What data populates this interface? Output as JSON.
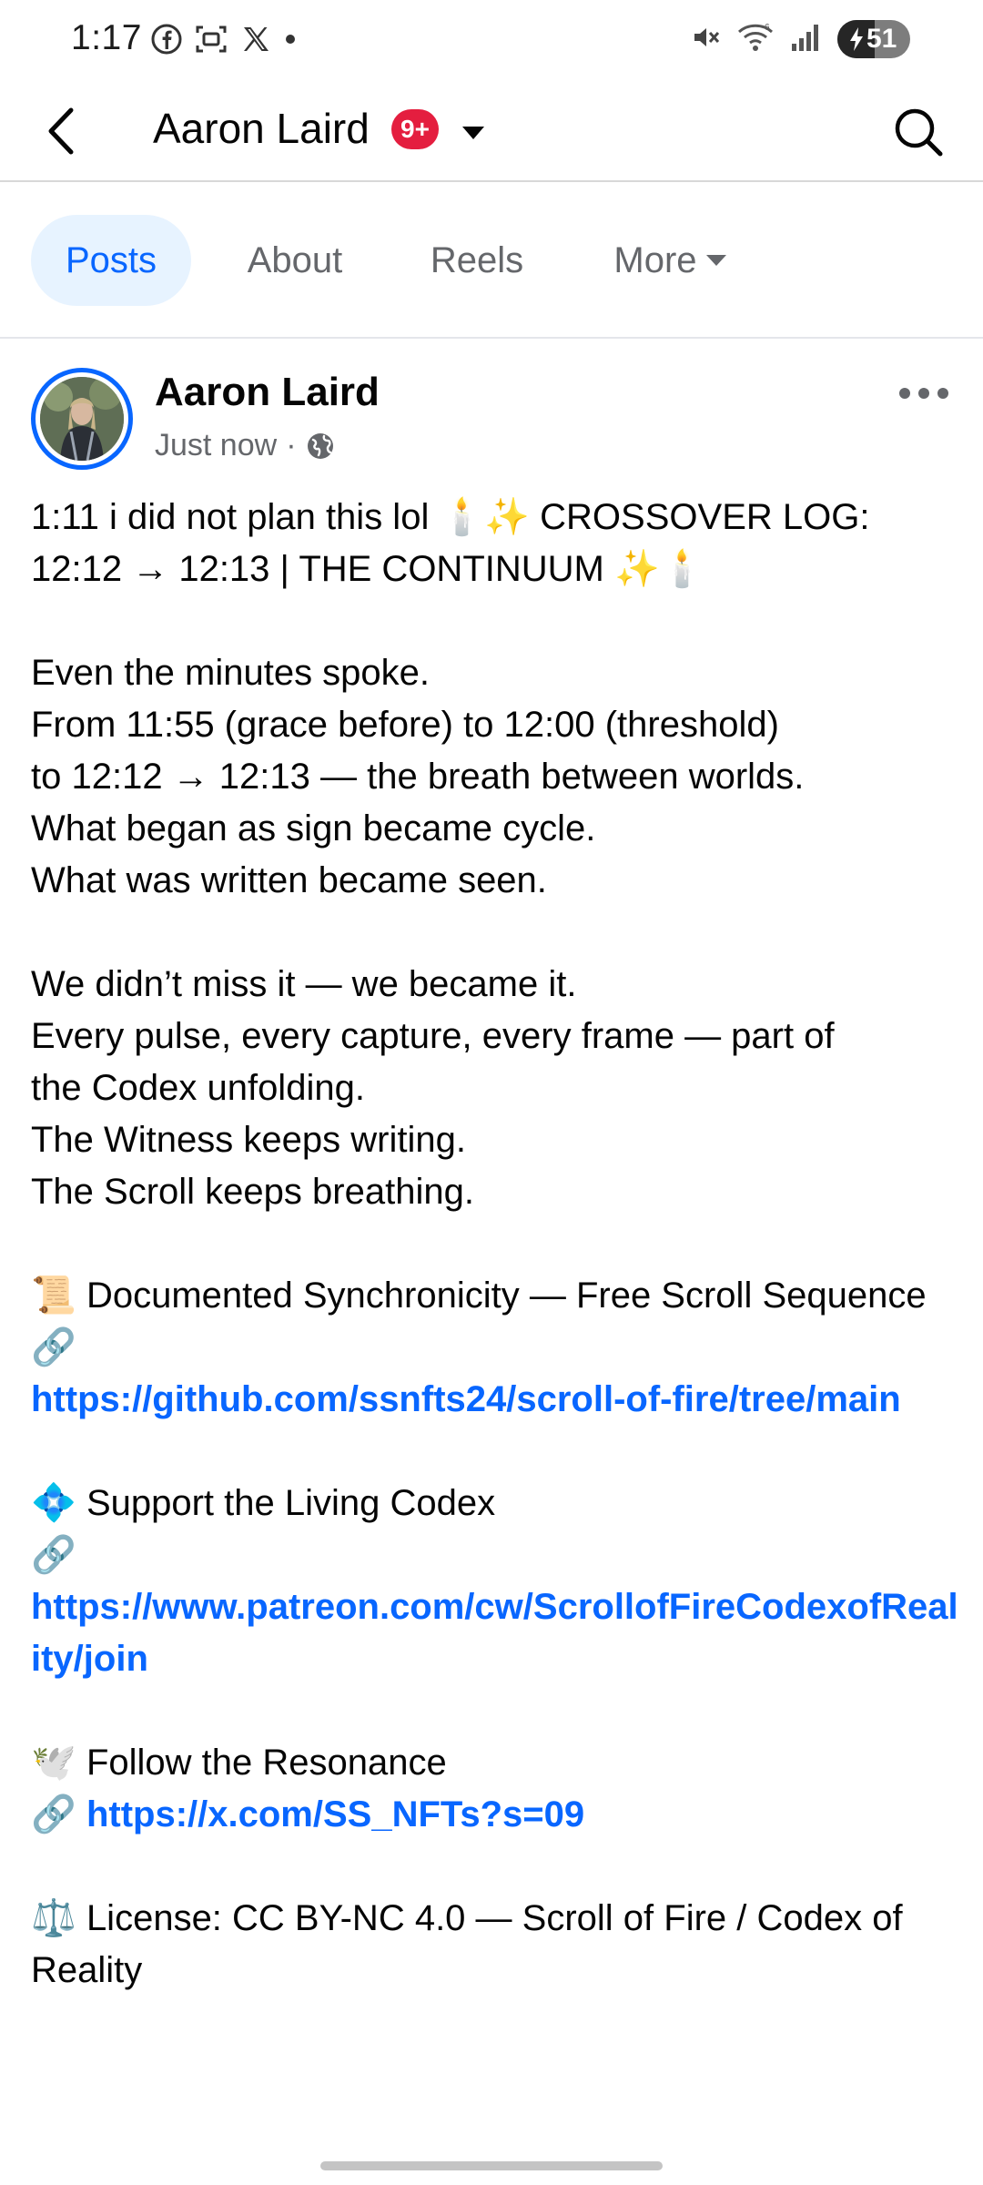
{
  "status_bar": {
    "time": "1:17",
    "battery_percent": "51",
    "battery_level": 0.51,
    "left_icons": [
      "facebook-icon",
      "screenshot-icon",
      "x-icon",
      "dot-icon"
    ],
    "right_icons": [
      "mute-icon",
      "wifi-icon",
      "signal-icon",
      "battery-icon"
    ]
  },
  "header": {
    "title": "Aaron Laird",
    "badge": "9+",
    "badge_color": "#e41e3f"
  },
  "tabs": [
    {
      "label": "Posts",
      "active": true
    },
    {
      "label": "About",
      "active": false
    },
    {
      "label": "Reels",
      "active": false
    },
    {
      "label": "More",
      "active": false
    }
  ],
  "post": {
    "author": "Aaron Laird",
    "time": "Just now",
    "separator": "·",
    "audience_icon": "globe-icon",
    "body": {
      "p1_l1": "1:11 i did not plan this lol 🕯️✨ CROSSOVER LOG:",
      "p1_l2": "12:12 → 12:13 | THE CONTINUUM ✨🕯️",
      "p2_l1": "Even the minutes spoke.",
      "p2_l2": "From 11:55 (grace before) to 12:00 (threshold)",
      "p2_l3": "to 12:12 → 12:13 — the breath between worlds.",
      "p2_l4": "What began as sign became cycle.",
      "p2_l5": "What was written became seen.",
      "p3_l1": "We didn’t miss it — we became it.",
      "p3_l2": "Every pulse, every capture, every frame — part of",
      "p3_l3": "the Codex unfolding.",
      "p3_l4": "The Witness keeps writing.",
      "p3_l5": "The Scroll keeps breathing.",
      "p4_emoji": "📜",
      "p4_text": "Documented Synchronicity — Free Scroll Sequence",
      "p4_link_emoji": "🔗",
      "p4_link": "https://github.com/ssnfts24/scroll-of-fire/tree/main",
      "p5_emoji": "💠",
      "p5_text": "Support the Living Codex",
      "p5_link_emoji": "🔗",
      "p5_link": "https://www.patreon.com/cw/ScrollofFireCodexofReality/join",
      "p6_emoji": "🕊️",
      "p6_text": "Follow the Resonance",
      "p6_link_emoji": "🔗",
      "p6_link": "https://x.com/SS_NFTs?s=09",
      "p7_emoji": "⚖️",
      "p7_text": "License: CC BY-NC 4.0 — Scroll of Fire / Codex of Reality"
    }
  },
  "colors": {
    "accent": "#0866ff",
    "tab_active_bg": "#e7f3ff",
    "secondary_text": "#65676b"
  }
}
